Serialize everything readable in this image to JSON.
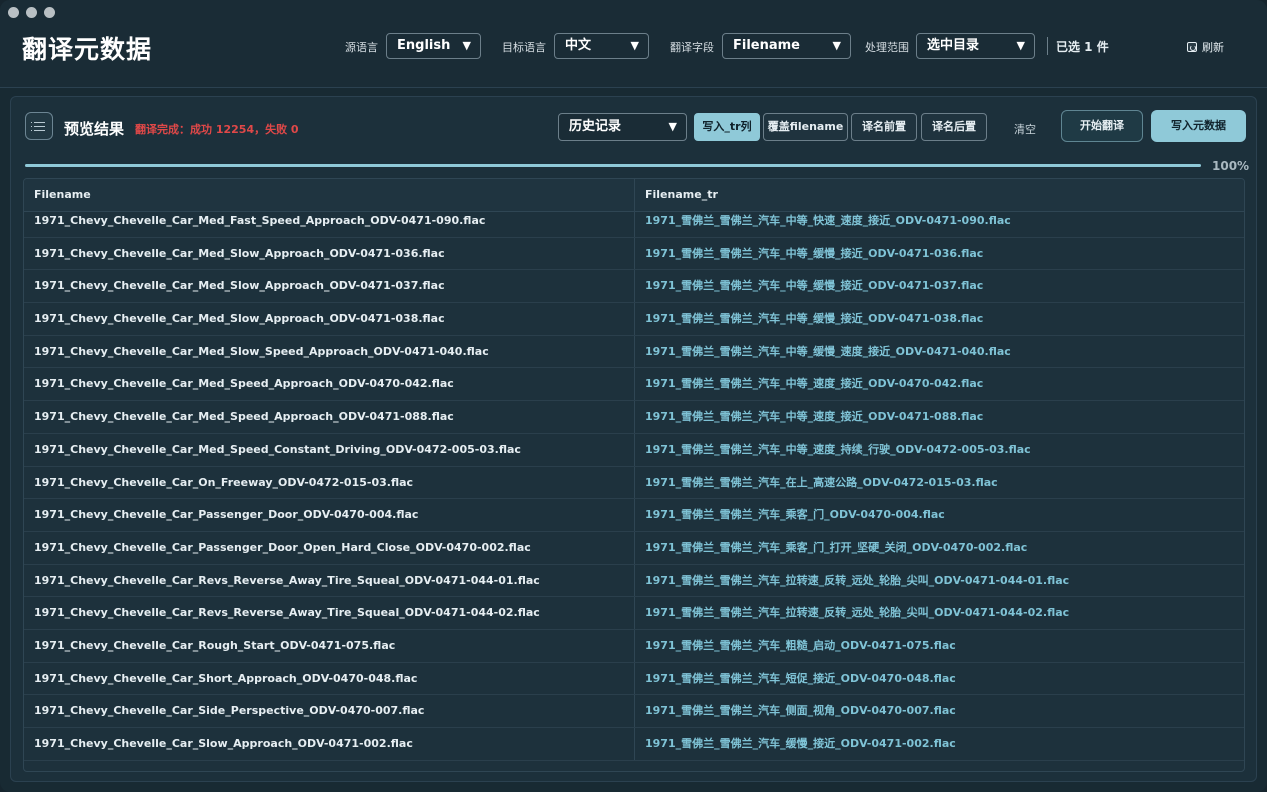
{
  "app": {
    "title": "翻译元数据"
  },
  "toolbar": {
    "source_lang_label": "源语言",
    "source_lang_value": "English",
    "target_lang_label": "目标语言",
    "target_lang_value": "中文",
    "field_label": "翻译字段",
    "field_value": "Filename",
    "scope_label": "处理范围",
    "scope_value": "选中目录",
    "selected_count": "已选 1 件",
    "refresh_label": "刷新"
  },
  "panel": {
    "title": "预览结果",
    "status": "翻译完成：成功 12254，失败 0",
    "history_select": "历史记录",
    "buttons": {
      "write_tr_col": "写入_tr列",
      "overwrite_filename": "覆盖filename",
      "prefix": "译名前置",
      "suffix": "译名后置",
      "clear": "清空",
      "start": "开始翻译",
      "write_meta": "写入元数据"
    },
    "progress": {
      "percent_value": 100,
      "percent_label": "100%"
    }
  },
  "table": {
    "columns": [
      "Filename",
      "Filename_tr"
    ],
    "rows": [
      [
        "1971_Chevy_Chevelle_Car_Med_Fast_Speed_Approach_ODV-0471-090.flac",
        "1971_雪佛兰_雪佛兰_汽车_中等_快速_速度_接近_ODV-0471-090.flac"
      ],
      [
        "1971_Chevy_Chevelle_Car_Med_Slow_Approach_ODV-0471-036.flac",
        "1971_雪佛兰_雪佛兰_汽车_中等_缓慢_接近_ODV-0471-036.flac"
      ],
      [
        "1971_Chevy_Chevelle_Car_Med_Slow_Approach_ODV-0471-037.flac",
        "1971_雪佛兰_雪佛兰_汽车_中等_缓慢_接近_ODV-0471-037.flac"
      ],
      [
        "1971_Chevy_Chevelle_Car_Med_Slow_Approach_ODV-0471-038.flac",
        "1971_雪佛兰_雪佛兰_汽车_中等_缓慢_接近_ODV-0471-038.flac"
      ],
      [
        "1971_Chevy_Chevelle_Car_Med_Slow_Speed_Approach_ODV-0471-040.flac",
        "1971_雪佛兰_雪佛兰_汽车_中等_缓慢_速度_接近_ODV-0471-040.flac"
      ],
      [
        "1971_Chevy_Chevelle_Car_Med_Speed_Approach_ODV-0470-042.flac",
        "1971_雪佛兰_雪佛兰_汽车_中等_速度_接近_ODV-0470-042.flac"
      ],
      [
        "1971_Chevy_Chevelle_Car_Med_Speed_Approach_ODV-0471-088.flac",
        "1971_雪佛兰_雪佛兰_汽车_中等_速度_接近_ODV-0471-088.flac"
      ],
      [
        "1971_Chevy_Chevelle_Car_Med_Speed_Constant_Driving_ODV-0472-005-03.flac",
        "1971_雪佛兰_雪佛兰_汽车_中等_速度_持续_行驶_ODV-0472-005-03.flac"
      ],
      [
        "1971_Chevy_Chevelle_Car_On_Freeway_ODV-0472-015-03.flac",
        "1971_雪佛兰_雪佛兰_汽车_在上_高速公路_ODV-0472-015-03.flac"
      ],
      [
        "1971_Chevy_Chevelle_Car_Passenger_Door_ODV-0470-004.flac",
        "1971_雪佛兰_雪佛兰_汽车_乘客_门_ODV-0470-004.flac"
      ],
      [
        "1971_Chevy_Chevelle_Car_Passenger_Door_Open_Hard_Close_ODV-0470-002.flac",
        "1971_雪佛兰_雪佛兰_汽车_乘客_门_打开_坚硬_关闭_ODV-0470-002.flac"
      ],
      [
        "1971_Chevy_Chevelle_Car_Revs_Reverse_Away_Tire_Squeal_ODV-0471-044-01.flac",
        "1971_雪佛兰_雪佛兰_汽车_拉转速_反转_远处_轮胎_尖叫_ODV-0471-044-01.flac"
      ],
      [
        "1971_Chevy_Chevelle_Car_Revs_Reverse_Away_Tire_Squeal_ODV-0471-044-02.flac",
        "1971_雪佛兰_雪佛兰_汽车_拉转速_反转_远处_轮胎_尖叫_ODV-0471-044-02.flac"
      ],
      [
        "1971_Chevy_Chevelle_Car_Rough_Start_ODV-0471-075.flac",
        "1971_雪佛兰_雪佛兰_汽车_粗糙_启动_ODV-0471-075.flac"
      ],
      [
        "1971_Chevy_Chevelle_Car_Short_Approach_ODV-0470-048.flac",
        "1971_雪佛兰_雪佛兰_汽车_短促_接近_ODV-0470-048.flac"
      ],
      [
        "1971_Chevy_Chevelle_Car_Side_Perspective_ODV-0470-007.flac",
        "1971_雪佛兰_雪佛兰_汽车_侧面_视角_ODV-0470-007.flac"
      ],
      [
        "1971_Chevy_Chevelle_Car_Slow_Approach_ODV-0471-002.flac",
        "1971_雪佛兰_雪佛兰_汽车_缓慢_接近_ODV-0471-002.flac"
      ]
    ]
  },
  "colors": {
    "accent": "#8fc9d8",
    "translated_text": "#7fc3d6",
    "status_error": "#e04848",
    "background": "#182a33"
  }
}
